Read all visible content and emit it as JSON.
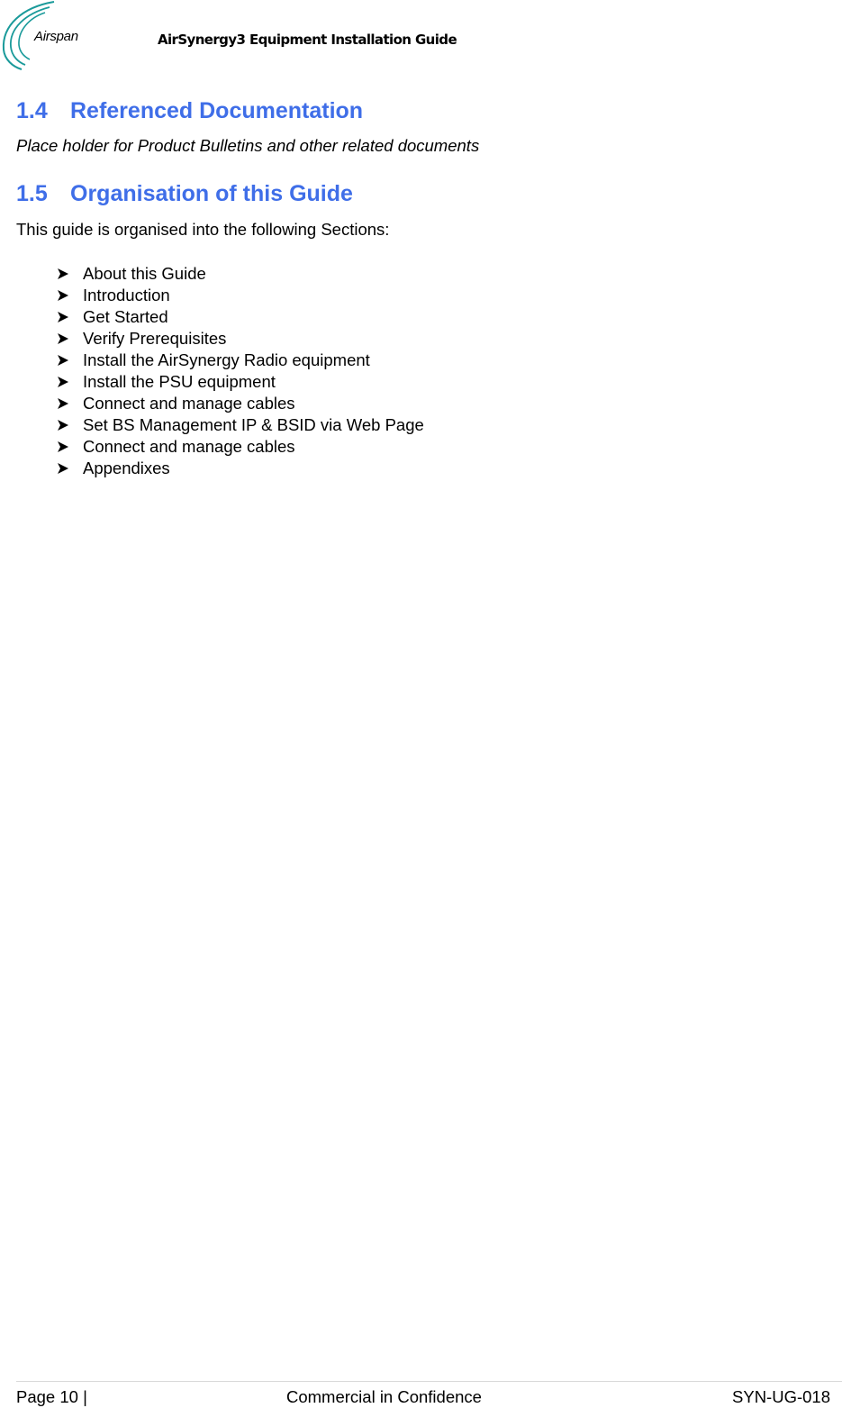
{
  "header": {
    "logo_text": "Airspan",
    "doc_title": "AirSynergy3 Equipment Installation Guide",
    "logo_color": "#1a9a9a"
  },
  "sections": [
    {
      "number": "1.4",
      "title": "Referenced Documentation",
      "body": "Place holder for Product Bulletins and other related documents"
    },
    {
      "number": "1.5",
      "title": "Organisation of this Guide",
      "body": "This guide is organised into the following Sections:",
      "items": [
        "About this Guide",
        "Introduction",
        "Get Started",
        "Verify Prerequisites",
        "Install the AirSynergy Radio equipment",
        "Install the PSU equipment",
        "Connect and manage cables",
        "Set BS Management IP & BSID via Web Page",
        "Connect and manage cables",
        "Appendixes"
      ]
    }
  ],
  "footer": {
    "page": "Page 10 |",
    "confidentiality": "Commercial in Confidence",
    "doc_id": "SYN-UG-018"
  },
  "colors": {
    "heading": "#3f6ee8"
  }
}
